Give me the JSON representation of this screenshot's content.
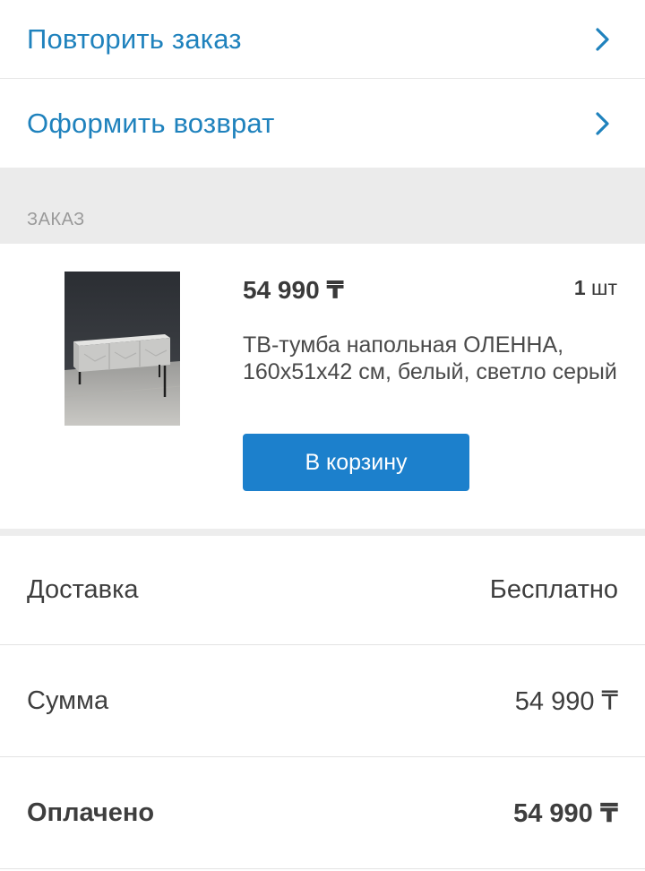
{
  "actions": {
    "repeat_order": "Повторить заказ",
    "return_order": "Оформить возврат"
  },
  "order_section": {
    "title": "ЗАКАЗ"
  },
  "item": {
    "price": "54 990 ₸",
    "quantity_value": "1",
    "quantity_unit": "шт",
    "description": "ТВ-тумба напольная ОЛЕННА, 160х51х42 см, белый, светло серый",
    "cart_button": "В корзину"
  },
  "summary": {
    "delivery_label": "Доставка",
    "delivery_value": "Бесплатно",
    "sum_label": "Сумма",
    "sum_value": "54 990 ₸",
    "paid_label": "Оплачено",
    "paid_value": "54 990 ₸"
  },
  "colors": {
    "accent": "#1f82bd",
    "button": "#1c80cc",
    "section_bg": "#ebebeb"
  },
  "icons": {
    "row_chevron": "chevron-right-icon",
    "product": "tv-stand-product-image"
  }
}
